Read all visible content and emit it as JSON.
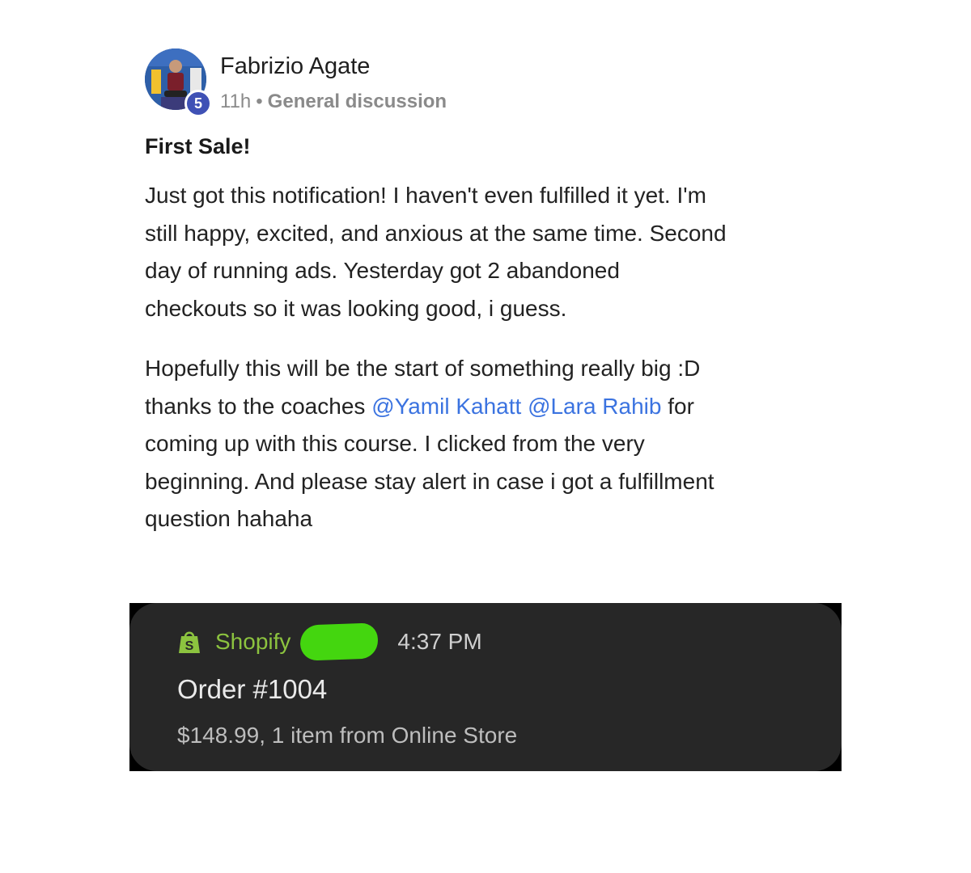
{
  "post": {
    "author": "Fabrizio Agate",
    "level": "5",
    "time": "11h",
    "separator": "•",
    "category": "General discussion",
    "title": "First Sale!",
    "paragraph1": "Just got this notification! I haven't even fulfilled it yet. I'm still happy, excited, and anxious at the same time. Second day of running ads. Yesterday got 2 abandoned checkouts so it was looking good, i guess.",
    "paragraph2": {
      "before": "Hopefully this will be the start of something really big :D thanks to the coaches ",
      "mention1": "@Yamil Kahatt",
      "between": " ",
      "mention2": "@Lara Rahib",
      "after": " for coming up with this course. I clicked from the very beginning. And please stay alert in case i got a fulfillment question hahaha"
    }
  },
  "notification": {
    "app_icon": "shopify-bag-icon",
    "app_name": "Shopify",
    "time": "4:37 PM",
    "title": "Order #1004",
    "detail": "$148.99, 1 item from Online Store"
  },
  "colors": {
    "mention": "#3b73e0",
    "badge": "#3f51b5",
    "shopify_green": "#8cc33f",
    "notification_bg": "#272727",
    "redaction": "#44d60f"
  }
}
